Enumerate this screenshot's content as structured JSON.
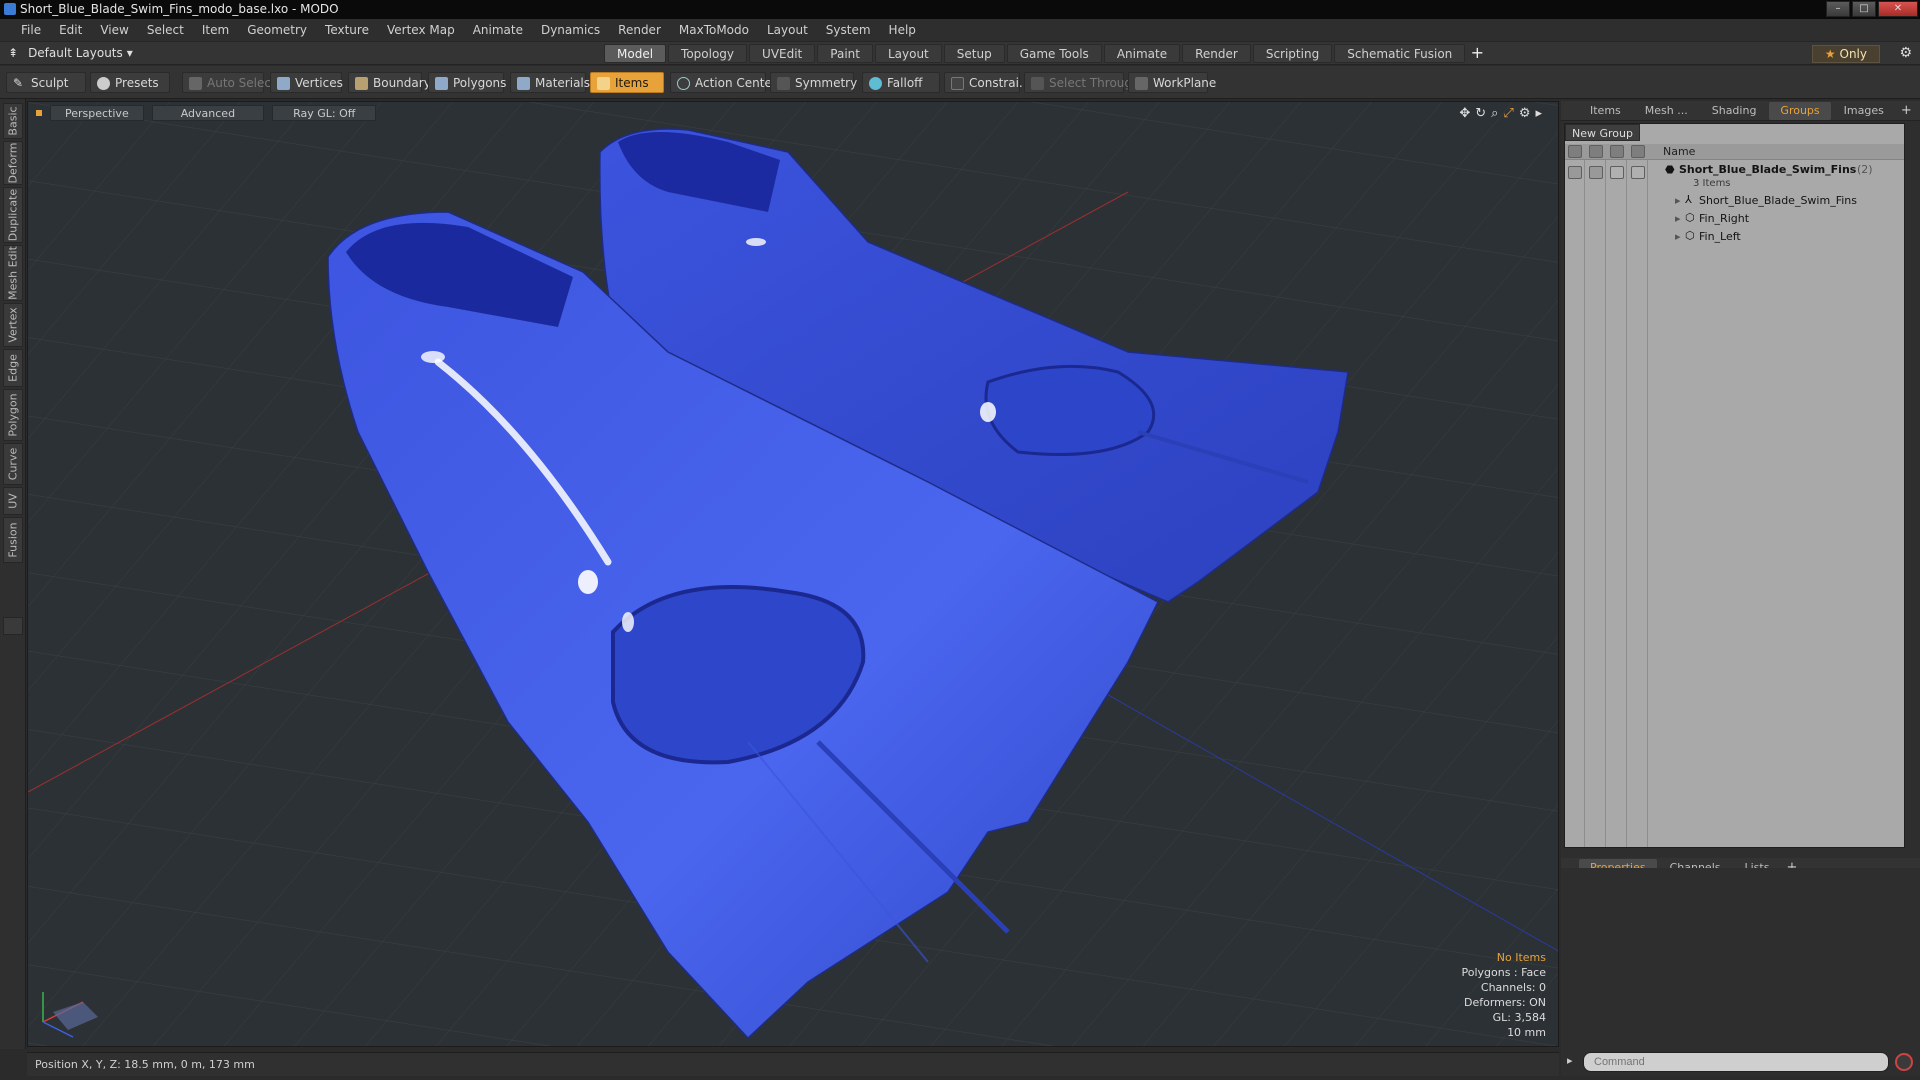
{
  "window": {
    "title": "Short_Blue_Blade_Swim_Fins_modo_base.lxo - MODO"
  },
  "menu": [
    "File",
    "Edit",
    "View",
    "Select",
    "Item",
    "Geometry",
    "Texture",
    "Vertex Map",
    "Animate",
    "Dynamics",
    "Render",
    "MaxToModo",
    "Layout",
    "System",
    "Help"
  ],
  "layoutbar": {
    "layouts_label": "Default Layouts",
    "tabs": [
      "Model",
      "Topology",
      "UVEdit",
      "Paint",
      "Layout",
      "Setup",
      "Game Tools",
      "Animate",
      "Render",
      "Scripting",
      "Schematic Fusion"
    ],
    "active_tab": "Model",
    "only_label": "Only"
  },
  "toolbar": {
    "sculpt": "Sculpt",
    "presets": "Presets",
    "auto_select": "Auto Select",
    "vertices": "Vertices",
    "boundary": "Boundary",
    "polygons": "Polygons",
    "materials": "Materials",
    "items": "Items",
    "action_center": "Action Center",
    "symmetry": "Symmetry",
    "falloff": "Falloff",
    "constraints": "Constrai...",
    "select_through": "Select Through",
    "workplane": "WorkPlane"
  },
  "left_tabs": [
    "Basic",
    "Deform",
    "Duplicate",
    "Mesh Edit",
    "Vertex",
    "Edge",
    "Polygon",
    "Curve",
    "UV",
    "Fusion"
  ],
  "viewport": {
    "view_mode": "Perspective",
    "shading": "Advanced",
    "raygl": "Ray GL: Off",
    "info": {
      "selection": "No Items",
      "polygons": "Polygons : Face",
      "channels": "Channels: 0",
      "deformers": "Deformers: ON",
      "gl": "GL: 3,584",
      "scale": "10 mm"
    },
    "model_color": "#3f5be6"
  },
  "status": {
    "position": "Position X, Y, Z:  18.5 mm, 0 m, 173 mm"
  },
  "right_panel": {
    "top_tabs": [
      "Items",
      "Mesh ...",
      "Shading",
      "Groups",
      "Images"
    ],
    "active_top_tab": "Groups",
    "new_group": "New Group",
    "column_name": "Name",
    "group": {
      "name": "Short_Blue_Blade_Swim_Fins",
      "count": "(2)",
      "items_count": "3 Items",
      "children": [
        "Short_Blue_Blade_Swim_Fins",
        "Fin_Right",
        "Fin_Left"
      ]
    },
    "bottom_tabs": [
      "Properties",
      "Channels",
      "Lists"
    ],
    "active_bottom_tab": "Properties",
    "command_placeholder": "Command"
  },
  "accent_color": "#e8a23a"
}
